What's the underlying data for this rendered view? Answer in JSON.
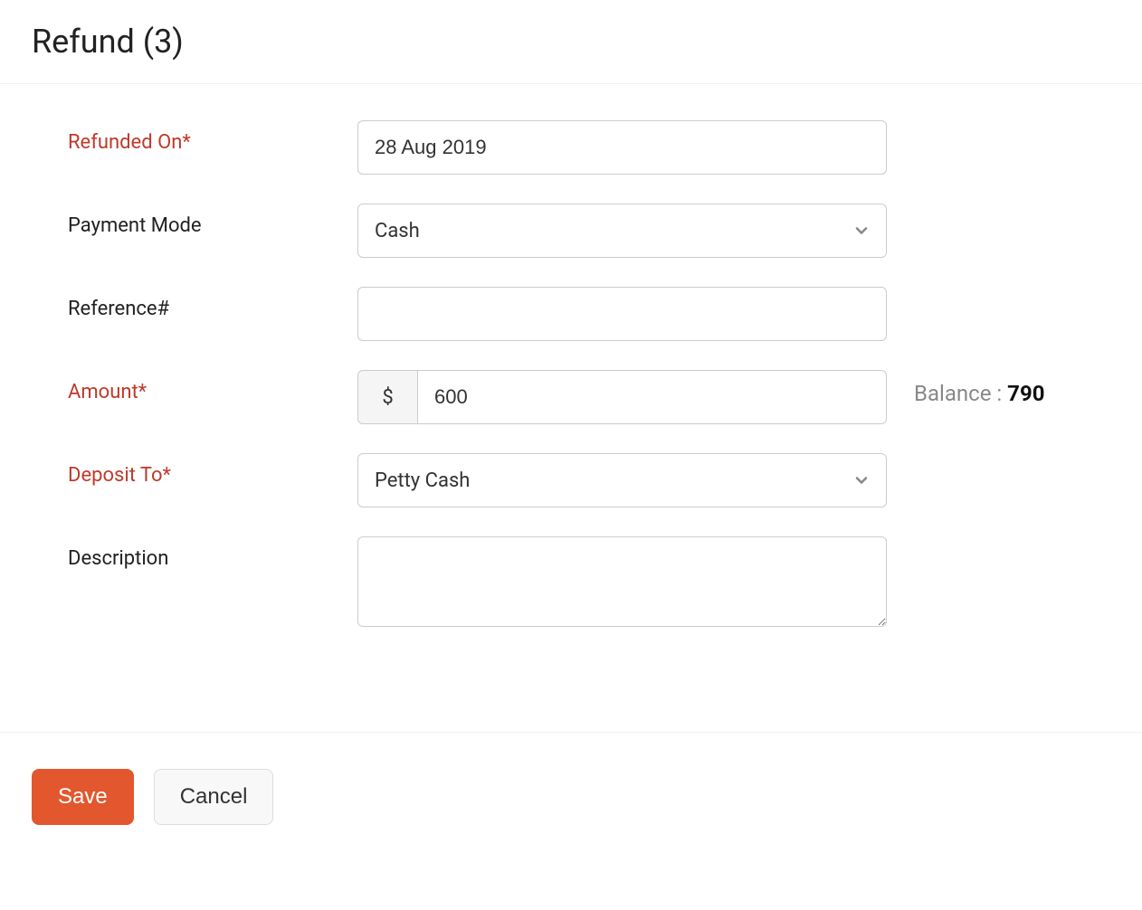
{
  "header": {
    "title": "Refund (3)"
  },
  "form": {
    "refunded_on": {
      "label": "Refunded On*",
      "value": "28 Aug 2019"
    },
    "payment_mode": {
      "label": "Payment Mode",
      "value": "Cash"
    },
    "reference": {
      "label": "Reference#",
      "value": ""
    },
    "amount": {
      "label": "Amount*",
      "currency": "$",
      "value": "600"
    },
    "balance": {
      "label": "Balance : ",
      "value": "790"
    },
    "deposit_to": {
      "label": "Deposit To*",
      "value": "Petty Cash"
    },
    "description": {
      "label": "Description",
      "value": ""
    }
  },
  "buttons": {
    "save": "Save",
    "cancel": "Cancel"
  }
}
